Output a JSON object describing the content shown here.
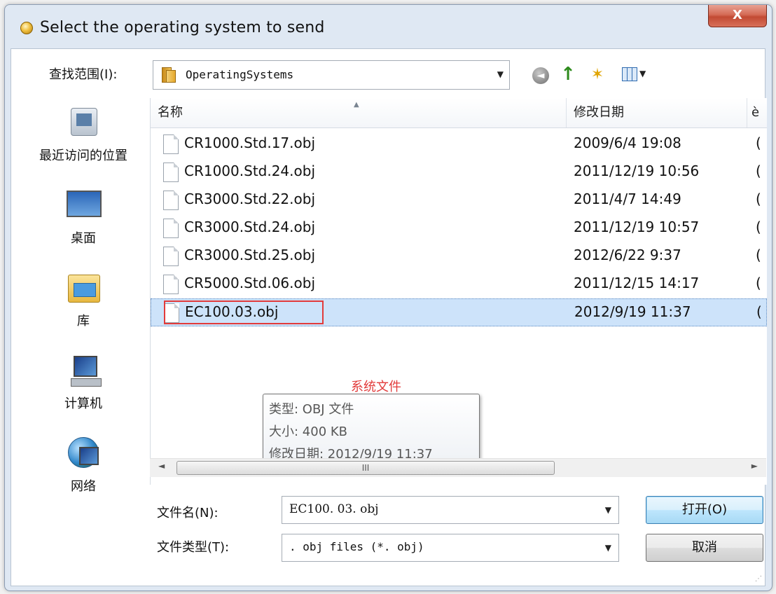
{
  "window": {
    "title": "Select the operating system to send",
    "close_glyph": "X"
  },
  "toolbar": {
    "lookin_label": "查找范围(I):",
    "lookin_value": "OperatingSystems",
    "icons": [
      "back-icon",
      "up-folder-icon",
      "new-folder-icon",
      "views-icon"
    ]
  },
  "places": [
    {
      "label": "最近访问的位置",
      "icon": "recent-places-icon"
    },
    {
      "label": "桌面",
      "icon": "desktop-icon"
    },
    {
      "label": "库",
      "icon": "library-icon"
    },
    {
      "label": "计算机",
      "icon": "computer-icon"
    },
    {
      "label": "网络",
      "icon": "network-icon"
    }
  ],
  "list": {
    "columns": {
      "name": "名称",
      "date": "修改日期",
      "third": "è"
    },
    "rows": [
      {
        "name": "CR1000.Std.17.obj",
        "date": "2009/6/4 19:08",
        "third": "("
      },
      {
        "name": "CR1000.Std.24.obj",
        "date": "2011/12/19 10:56",
        "third": "("
      },
      {
        "name": "CR3000.Std.22.obj",
        "date": "2011/4/7 14:49",
        "third": "("
      },
      {
        "name": "CR3000.Std.24.obj",
        "date": "2011/12/19 10:57",
        "third": "("
      },
      {
        "name": "CR3000.Std.25.obj",
        "date": "2012/6/22 9:37",
        "third": "("
      },
      {
        "name": "CR5000.Std.06.obj",
        "date": "2011/12/15 14:17",
        "third": "("
      },
      {
        "name": "EC100.03.obj",
        "date": "2012/9/19 11:37",
        "third": "(",
        "selected": true
      }
    ],
    "annotation": "系统文件",
    "tooltip": {
      "type_line": "类型: OBJ 文件",
      "size_line": "大小: 400 KB",
      "date_line": "修改日期: 2012/9/19 11:37"
    },
    "scroll_thumb_glyph": "III"
  },
  "form": {
    "filename_label": "文件名(N):",
    "filename_value": "EC100. 03. obj",
    "filetype_label": "文件类型(T):",
    "filetype_value": ". obj files (*. obj)"
  },
  "buttons": {
    "open": "打开(O)",
    "cancel": "取消"
  },
  "colors": {
    "annotation_red": "#e23b3b",
    "selection_blue": "#cde3fa",
    "close_red": "#c24a33"
  }
}
